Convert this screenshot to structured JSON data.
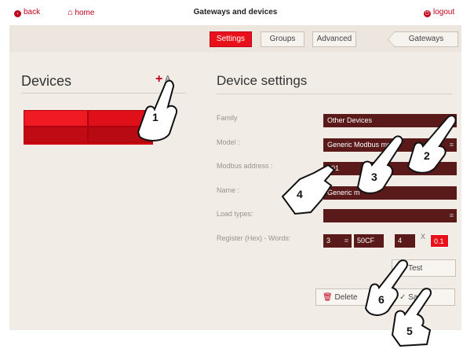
{
  "header": {
    "back_label": "back",
    "home_label": "home",
    "title": "Gateways and devices",
    "logout_label": "logout"
  },
  "tabs": {
    "settings": "Settings",
    "groups": "Groups",
    "advanced": "Advanced",
    "gateways": "Gateways"
  },
  "devices_panel": {
    "title": "Devices",
    "add_label": "A"
  },
  "settings_panel": {
    "title": "Device settings",
    "family_label": "Family",
    "family_value": "Other Devices",
    "model_label": "Model :",
    "model_value": "Generic Modbus me",
    "address_label": "Modbus address :",
    "address_value": "001",
    "name_label": "Name :",
    "name_value": "Generic m",
    "load_label": "Load types:",
    "load_value": "",
    "register_label": "Register (Hex) - Words:",
    "register_type": "3",
    "register_hex": "50CF",
    "words": "4",
    "x_label": "X",
    "multiplier": "0.1"
  },
  "buttons": {
    "test": "Test",
    "delete": "Delete",
    "save": "Save"
  },
  "callouts": [
    "1",
    "2",
    "3",
    "4",
    "5",
    "6"
  ],
  "colors": {
    "accent": "#e8101a",
    "field_bg": "#5a1a1a",
    "panel_bg": "#f1ece6"
  }
}
